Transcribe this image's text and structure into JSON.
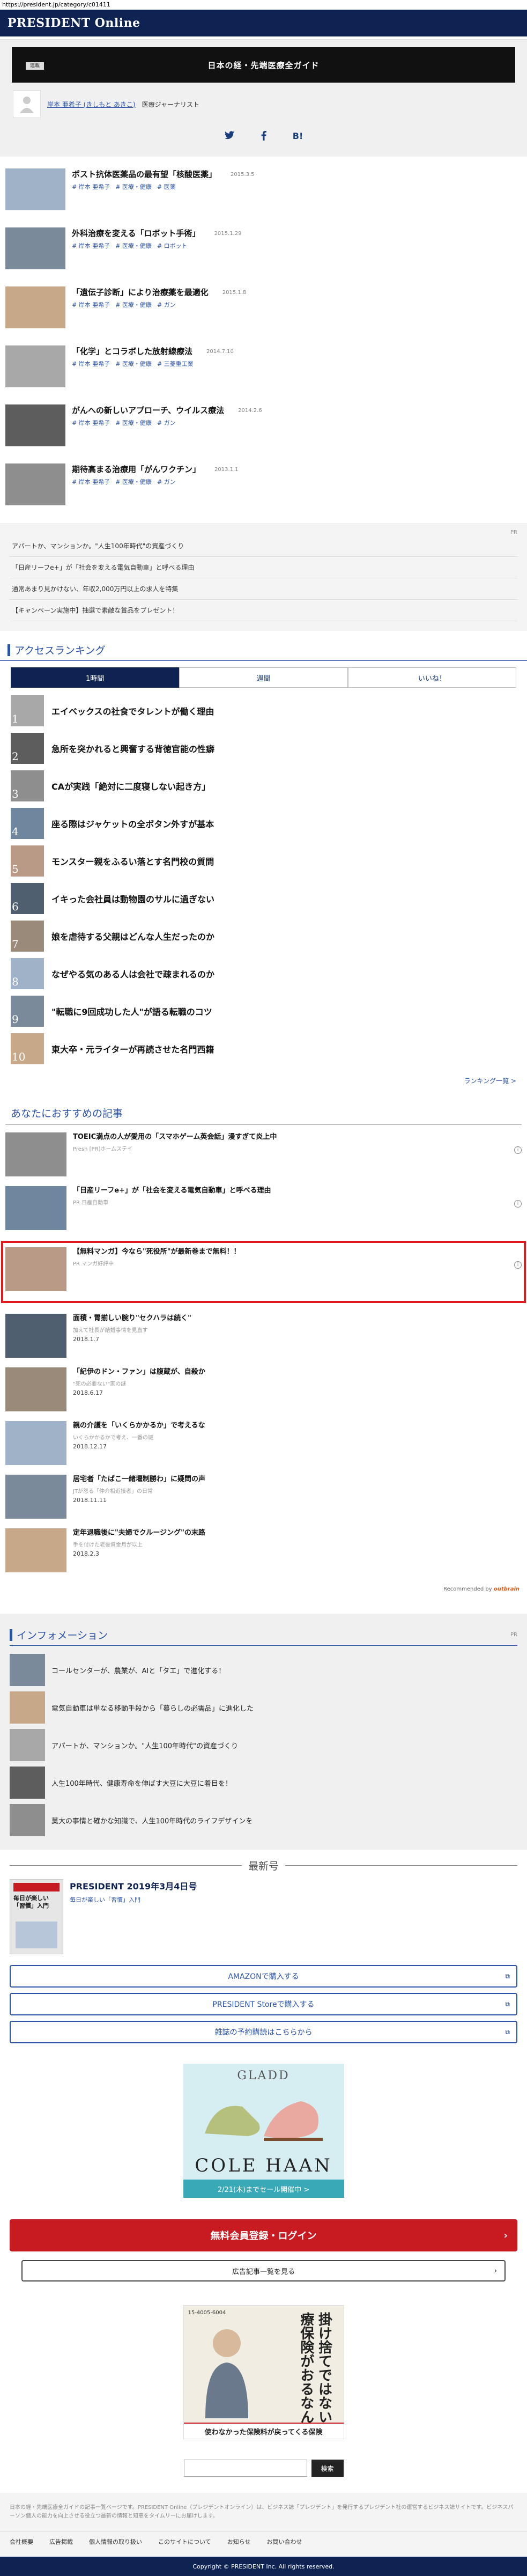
{
  "url": "https://president.jp/category/c01411",
  "brand": {
    "logo": "PRESIDENT Online"
  },
  "series": {
    "tag": "連載",
    "title": "日本の経・先端医療全ガイド",
    "author_name": "岸本 亜希子 (きしもと あきこ)",
    "author_role": "医療ジャーナリスト"
  },
  "share": {
    "twitter": "t",
    "facebook": "f",
    "hatena": "B!"
  },
  "articles": [
    {
      "title": "ポスト抗体医薬品の最有望「核酸医薬」",
      "date": "2015.3.5",
      "tags": [
        "岸本 亜希子",
        "医療・健康",
        "医薬"
      ]
    },
    {
      "title": "外科治療を変える「ロボット手術」",
      "date": "2015.1.29",
      "tags": [
        "岸本 亜希子",
        "医療・健康",
        "ロボット"
      ]
    },
    {
      "title": "「遺伝子診断」により治療薬を最適化",
      "date": "2015.1.8",
      "tags": [
        "岸本 亜希子",
        "医療・健康",
        "ガン"
      ]
    },
    {
      "title": "「化学」とコラボした放射線療法",
      "date": "2014.7.10",
      "tags": [
        "岸本 亜希子",
        "医療・健康",
        "三菱重工業"
      ]
    },
    {
      "title": "がんへの新しいアプローチ、ウイルス療法",
      "date": "2014.2.6",
      "tags": [
        "岸本 亜希子",
        "医療・健康",
        "ガン"
      ]
    },
    {
      "title": "期待高まる治療用「がんワクチン」",
      "date": "2013.1.1",
      "tags": [
        "岸本 亜希子",
        "医療・健康",
        "ガン"
      ]
    }
  ],
  "pr": {
    "tag": "PR",
    "items": [
      "アパートか、マンションか。\"人生100年時代\"の資産づくり",
      "「日産リーフe+」が「社会を変える電気自動車」と呼べる理由",
      "通常あまり見かけない、年収2,000万円以上の求人を特集",
      "【キャンペーン実施中】抽選で素敵な賞品をプレゼント！"
    ]
  },
  "ranking": {
    "title": "アクセスランキング",
    "tabs": [
      "1時間",
      "週間",
      "いいね！"
    ],
    "items": [
      "エイベックスの社食でタレントが働く理由",
      "急所を突かれると興奮する背徳官能の性癖",
      "CAが実践「絶対に二度寝しない起き方」",
      "座る際はジャケットの全ボタン外すが基本",
      "モンスター親をふるい落とす名門校の質問",
      "イキった会社員は動物園のサルに過ぎない",
      "娘を虐待する父親はどんな人生だったのか",
      "なぜやる気のある人は会社で疎まれるのか",
      "\"転職に9回成功した人\"が語る転職のコツ",
      "東大卒・元ライターが再読させた名門西籍"
    ],
    "more": "ランキング一覧 >"
  },
  "recommend": {
    "title": "あなたにおすすめの記事",
    "items": [
      {
        "title": "TOEIC満点の人が愛用の「スマホゲーム英会話」漫すぎて炎上中",
        "source": "Presh [PR]ホームステイ",
        "date": ""
      },
      {
        "title": "「日産リーフe+」が「社会を変える電気自動車」と呼べる理由",
        "source": "PR 日産自動車",
        "date": ""
      },
      {
        "title": "【無料マンガ】今なら\"死役所\"が最新巻まで無料！！",
        "source": "PR マンガ好評中",
        "date": ""
      },
      {
        "title": "面積・胃揃しい腕り\"セクハラは続く\"",
        "source": "加えて社長が結婚事情を見直す",
        "date": "2018.1.7"
      },
      {
        "title": "「紀伊のドン・ファン」は腹蔵が、自殺か",
        "source": "\"死の必要ない\"家の謎",
        "date": "2018.6.17"
      },
      {
        "title": "親の介護を「いくらかかるか」で考えるな",
        "source": "いくらかかるかで考え、一番の謎",
        "date": "2018.12.17"
      },
      {
        "title": "居宅者「たばこ一緒堰制勝わ」に疑問の声",
        "source": "JTが怒る「仲介相近接者」の日常",
        "date": "2018.11.11"
      },
      {
        "title": "定年退職後に\"夫婦でクルージング\"の末路",
        "source": "手を付けた老後資金月が以上",
        "date": "2018.2.3"
      }
    ],
    "credit_label": "Recommended by",
    "credit_brand": "outbrain"
  },
  "information": {
    "title": "インフォメーション",
    "tag": "PR",
    "items": [
      "コールセンターが、農業が、AIと「タエ」で進化する！",
      "電気自動車は単なる移動手段から「暮らしの必需品」に進化した",
      "アパートか、マンションか。\"人生100年時代\"の資産づくり",
      "人生100年時代、健康寿命を伸ばす大豆に大豆に着目を！",
      "莫大の事情と確かな知識で、人生100年時代のライフデザインを"
    ]
  },
  "latest": {
    "heading": "最新号",
    "cover_caption": "毎日が楽しい「習慣」入門",
    "title": "PRESIDENT 2019年3月4日号",
    "subtitle": "毎日が楽しい「習慣」入門"
  },
  "buttons": {
    "amazon": "AMAZONで購入する",
    "store": "PRESIDENT Storeで購入する",
    "subscribe": "雑誌の予約購読はこちらから",
    "register": "無料会員登録・ログイン",
    "ad_list": "広告記事一覧を見る",
    "search": "検索"
  },
  "ads": {
    "cole_top": "GLADD",
    "cole_brand": "COLE HAAN",
    "cole_foot": "2/21(木)までセール開催中 >",
    "ins_tel": "15-4005-6004",
    "ins_vertical": "掛け捨てではない医療保険がおるなんて",
    "ins_foot": "使わなかった保険料が戻ってくる保険"
  },
  "footer": {
    "note": "日本の経・先端医療全ガイドの記事一覧ページです。PRESIDENT Online（プレジデントオンライン）は、ビジネス誌「プレジデント」を発行するプレジデント社の運営するビジネス誌サイトです。ビジネスパーソン個人の能力を向上させる役立つ最新の情報と知恵をタイムリーにお届けします。",
    "links": [
      "会社概要",
      "広告掲載",
      "個人情報の取り扱い",
      "このサイトについて",
      "お知らせ",
      "お問い合わせ"
    ],
    "copyright": "Copyright © PRESIDENT Inc. All rights reserved."
  }
}
